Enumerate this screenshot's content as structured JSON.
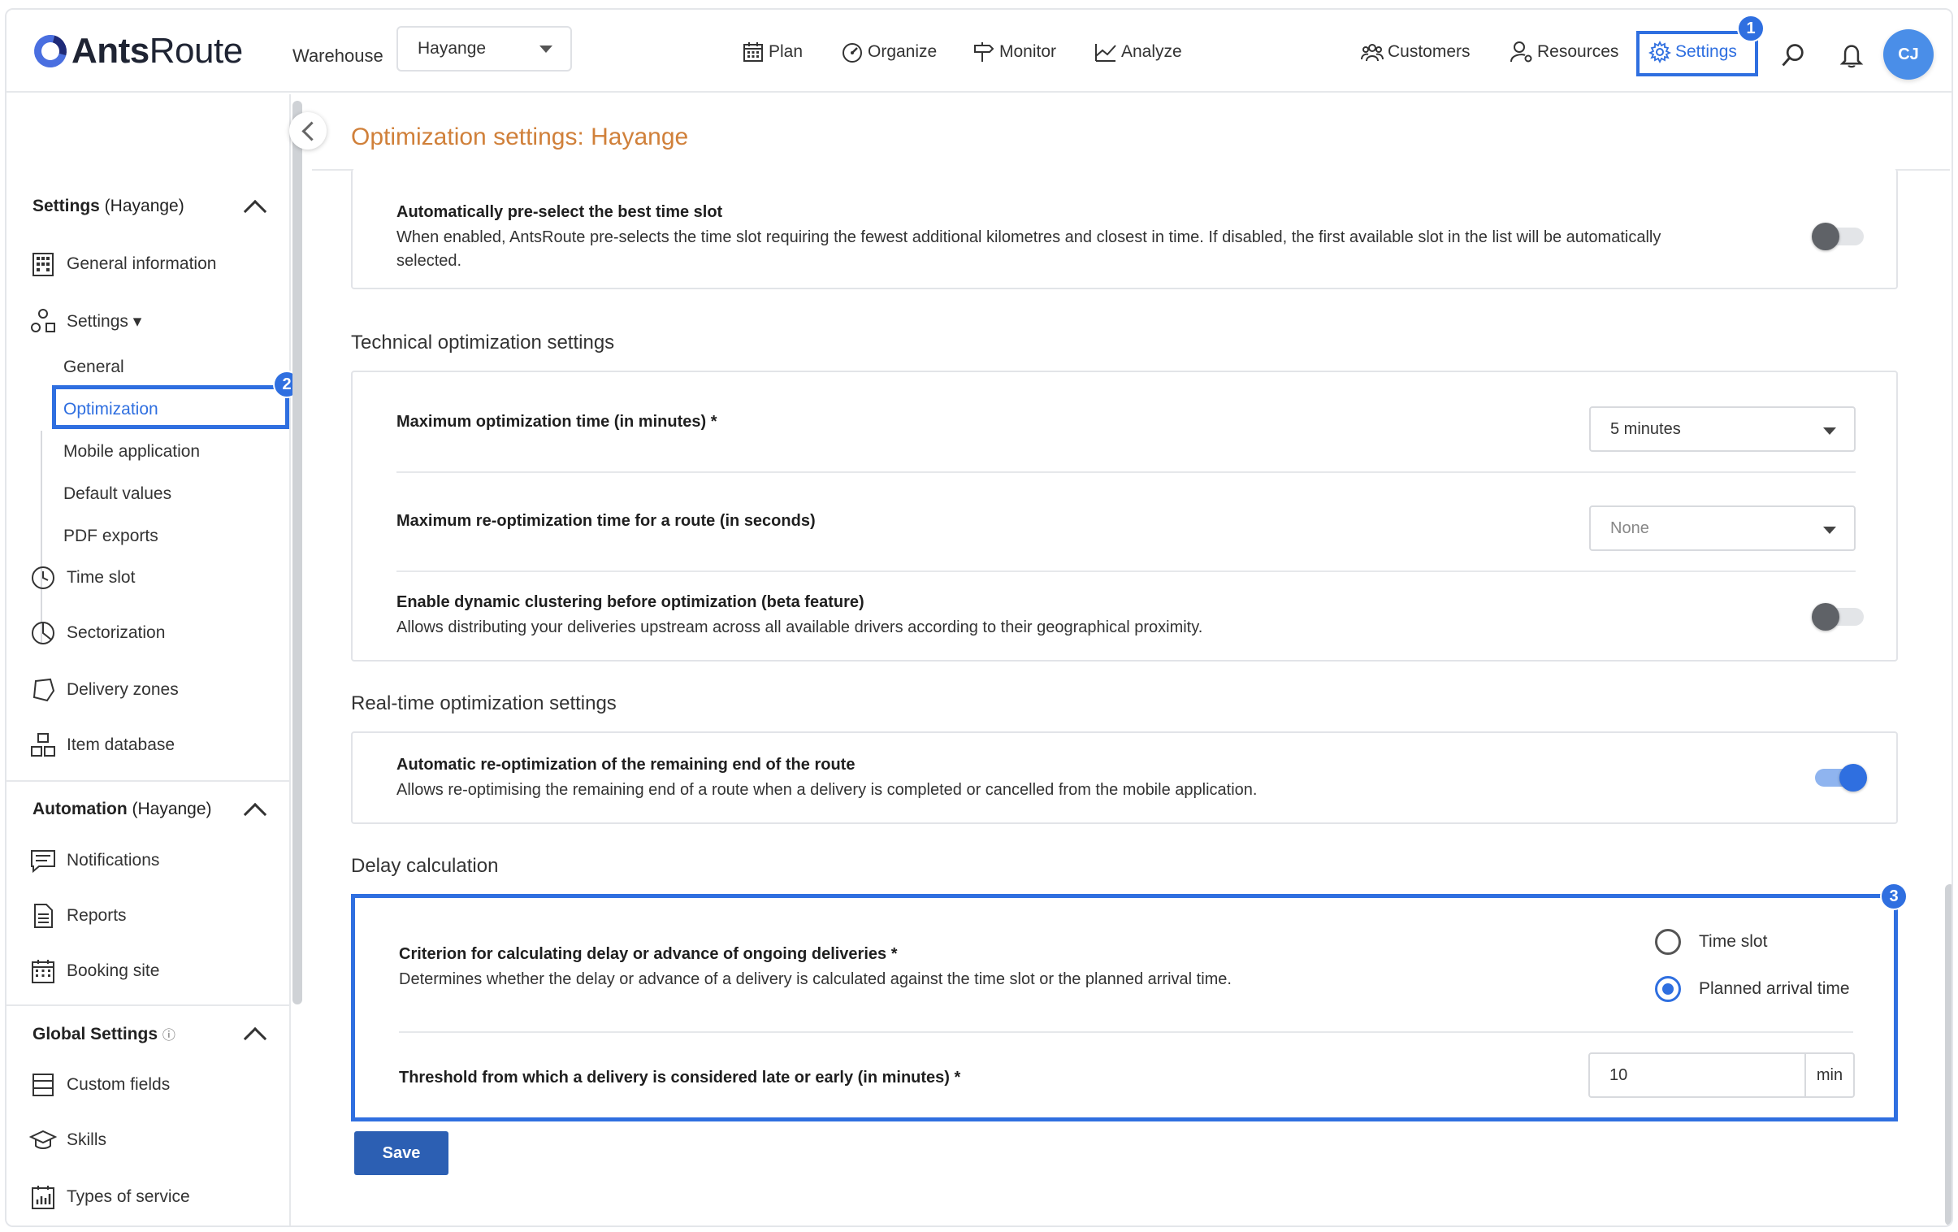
{
  "app": {
    "logo_bold": "Ants",
    "logo_rest": "Route"
  },
  "header": {
    "warehouse_label": "Warehouse",
    "warehouse_value": "Hayange",
    "nav": {
      "plan": "Plan",
      "organize": "Organize",
      "monitor": "Monitor",
      "analyze": "Analyze",
      "customers": "Customers",
      "resources": "Resources",
      "settings": "Settings"
    },
    "avatar_initials": "CJ",
    "badges": {
      "settings": "1",
      "optimization": "2",
      "delay": "3"
    }
  },
  "sidebar": {
    "settings_section": {
      "bold": "Settings",
      "rest": " (Hayange)"
    },
    "general_information": "General information",
    "settings_item": "Settings ▾",
    "sub_items": {
      "general": "General",
      "optimization": "Optimization",
      "mobile": "Mobile application",
      "defaults": "Default values",
      "pdf": "PDF exports"
    },
    "time_slot": "Time slot",
    "sectorization": "Sectorization",
    "delivery_zones": "Delivery zones",
    "item_database": "Item database",
    "automation_section": {
      "bold": "Automation",
      "rest": " (Hayange)"
    },
    "notifications": "Notifications",
    "reports": "Reports",
    "booking_site": "Booking site",
    "global_section": {
      "bold": "Global Settings",
      "info": "ⓘ"
    },
    "custom_fields": "Custom fields",
    "skills": "Skills",
    "types_of_service": "Types of service"
  },
  "main": {
    "title": "Optimization settings: Hayange",
    "preselect": {
      "title": "Automatically pre-select the best time slot",
      "desc": "When enabled, AntsRoute pre-selects the time slot requiring the fewest additional kilometres and closest in time. If disabled, the first available slot in the list will be automatically selected.",
      "enabled": false
    },
    "technical": {
      "section_title": "Technical optimization settings",
      "max_opt_time": {
        "title": "Maximum optimization time (in minutes) *",
        "value": "5 minutes"
      },
      "max_reopt_time": {
        "title": "Maximum re-optimization time for a route (in seconds)",
        "value": "None"
      },
      "clustering": {
        "title": "Enable dynamic clustering before optimization (beta feature)",
        "desc": "Allows distributing your deliveries upstream across all available drivers according to their geographical proximity.",
        "enabled": false
      }
    },
    "realtime": {
      "section_title": "Real-time optimization settings",
      "reopt": {
        "title": "Automatic re-optimization of the remaining end of the route",
        "desc": "Allows re-optimising the remaining end of a route when a delivery is completed or cancelled from the mobile application.",
        "enabled": true
      }
    },
    "delay": {
      "section_title": "Delay calculation",
      "criterion": {
        "title": "Criterion for calculating delay or advance of ongoing deliveries *",
        "desc": "Determines whether the delay or advance of a delivery is calculated against the time slot or the planned arrival time.",
        "options": [
          "Time slot",
          "Planned arrival time"
        ],
        "selected": "Planned arrival time"
      },
      "threshold": {
        "title": "Threshold from which a delivery is considered late or early (in minutes) *",
        "value": "10",
        "unit": "min"
      }
    },
    "save_label": "Save"
  },
  "colors": {
    "accent": "#2f6fe0",
    "title_orange": "#d0803a",
    "save": "#2c5fb3"
  }
}
